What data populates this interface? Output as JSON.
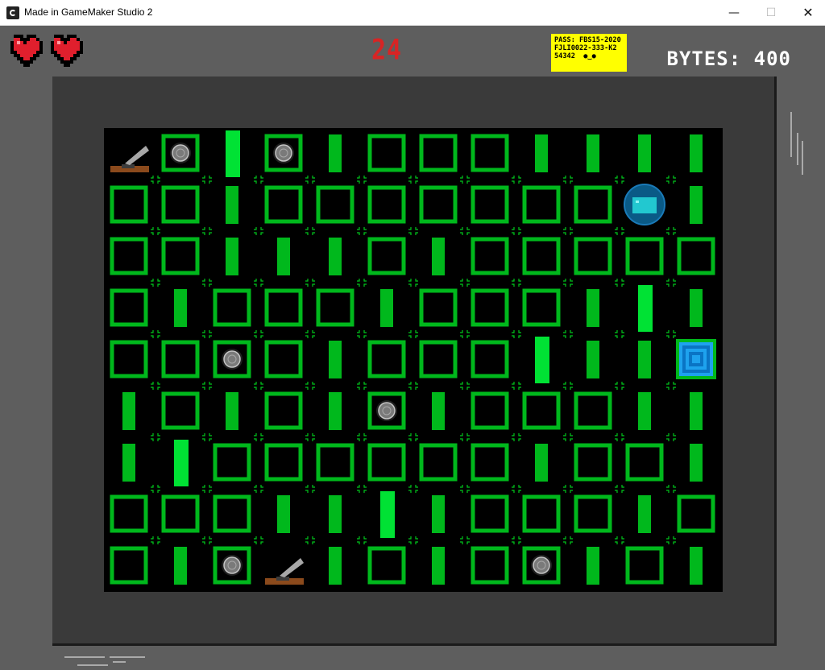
{
  "window": {
    "title": "Made in GameMaker Studio 2",
    "min_glyph": "—",
    "max_glyph": "☐",
    "close_glyph": "✕"
  },
  "hud": {
    "lives": 2,
    "heart_icon": "pixel-heart-icon",
    "timer": "24",
    "pass_note": {
      "line1": "PASS: FBS15-2020",
      "line2": "FJLI0022-333-K2",
      "line3": "54342",
      "line3_symbols": "●‿●"
    },
    "bytes_label": "BYTES: 400"
  },
  "colors": {
    "board_bg": "#000000",
    "green": "#00b81c",
    "green_light": "#00e234",
    "corner_mark": "#00c81c",
    "timer_red": "#d82424",
    "note_yellow": "#ffff00",
    "bezel": "#3a3a3a",
    "frame": "#5e5e5e"
  },
  "board": {
    "cols": 12,
    "rows": 9,
    "legend": {
      "S": "green-square-chip",
      "C": "green-square-with-disc",
      "B": "green-bar",
      "T": "green-bar-tall",
      "L": "lever-switch",
      "O": "blue-orb-player",
      "P": "blue-portal-exit",
      ".": "empty"
    },
    "grid": [
      "LCTCBSSSBBBB",
      "SSBSSSSSSSOB",
      "SSBBBSBSSSSS",
      "SBSSSBSSSBTB",
      "SSCSBSSSTBBP",
      "BSBSBCBSSSBB",
      "BTSSSSSSBSSB",
      "SSSBBTBSSSBS",
      "SBCLBSBSCBSB"
    ]
  }
}
